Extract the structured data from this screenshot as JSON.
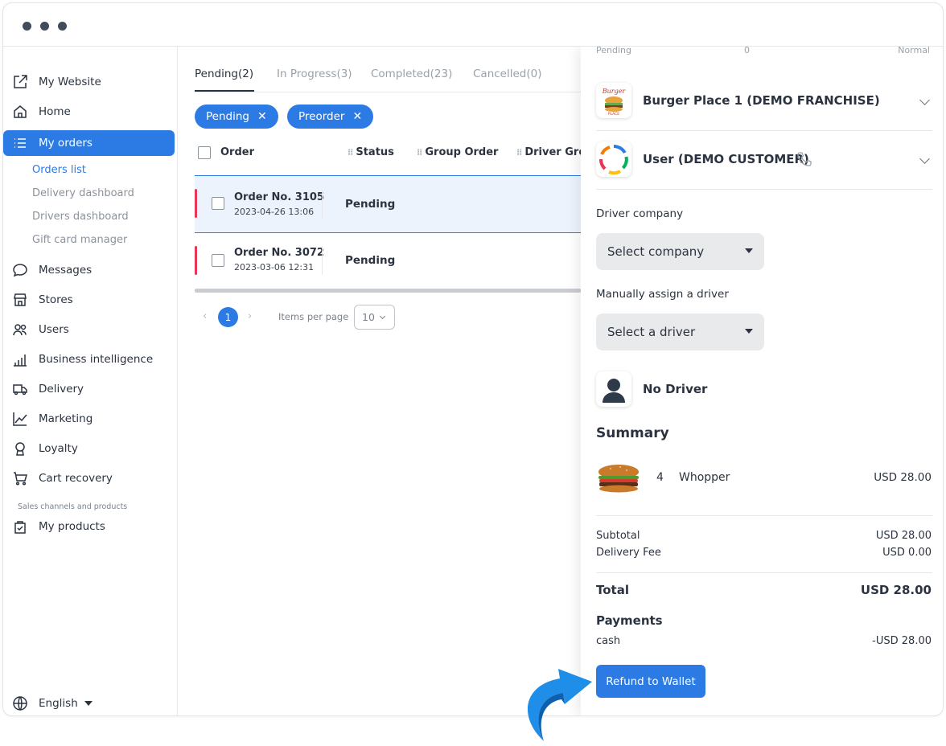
{
  "sidebar": {
    "items": [
      {
        "label": "My Website",
        "icon": "external-link-icon"
      },
      {
        "label": "Home",
        "icon": "home-icon"
      },
      {
        "label": "My orders",
        "icon": "list-icon"
      },
      {
        "label": "Messages",
        "icon": "chat-icon"
      },
      {
        "label": "Stores",
        "icon": "store-icon"
      },
      {
        "label": "Users",
        "icon": "users-icon"
      },
      {
        "label": "Business intelligence",
        "icon": "bar-chart-icon"
      },
      {
        "label": "Delivery",
        "icon": "truck-icon"
      },
      {
        "label": "Marketing",
        "icon": "line-chart-icon"
      },
      {
        "label": "Loyalty",
        "icon": "award-icon"
      },
      {
        "label": "Cart recovery",
        "icon": "cart-icon"
      },
      {
        "label": "My products",
        "icon": "bag-icon"
      }
    ],
    "subitems": [
      "Orders list",
      "Delivery dashboard",
      "Drivers dashboard",
      "Gift card manager"
    ],
    "section_label": "Sales channels and products",
    "language": "English"
  },
  "main": {
    "tabs": [
      "Pending(2)",
      "In Progress(3)",
      "Completed(23)",
      "Cancelled(0)"
    ],
    "chips": [
      "Pending",
      "Preorder"
    ],
    "columns": [
      "Order",
      "Status",
      "Group Order",
      "Driver Grou"
    ],
    "orders": [
      {
        "title": "Order No. 3105",
        "date": "2023-04-26 13:06",
        "status": "Pending"
      },
      {
        "title": "Order No. 3072",
        "date": "2023-03-06 12:31",
        "status": "Pending"
      }
    ],
    "pagination": {
      "current": "1",
      "items_per_page_label": "Items per page",
      "items_per_page": "10"
    }
  },
  "panel": {
    "top_row": {
      "left": "Pending",
      "middle": "0",
      "right": "Normal"
    },
    "business": "Burger Place 1 (DEMO FRANCHISE)",
    "customer": "User (DEMO CUSTOMER)",
    "driver_company_label": "Driver company",
    "driver_company_select": "Select company",
    "driver_label": "Manually assign a driver",
    "driver_select": "Select a driver",
    "no_driver": "No Driver",
    "summary_title": "Summary",
    "product": {
      "qty": "4",
      "name": "Whopper",
      "price": "USD 28.00"
    },
    "subtotal_label": "Subtotal",
    "subtotal": "USD 28.00",
    "delivery_fee_label": "Delivery Fee",
    "delivery_fee": "USD 0.00",
    "total_label": "Total",
    "total": "USD 28.00",
    "payments_title": "Payments",
    "payment_method": "cash",
    "payment_amount": "-USD 28.00",
    "refund_button": "Refund to Wallet"
  },
  "colors": {
    "accent": "#2c7be5",
    "danger": "#e63757",
    "arrow": "#1f8ee8"
  }
}
